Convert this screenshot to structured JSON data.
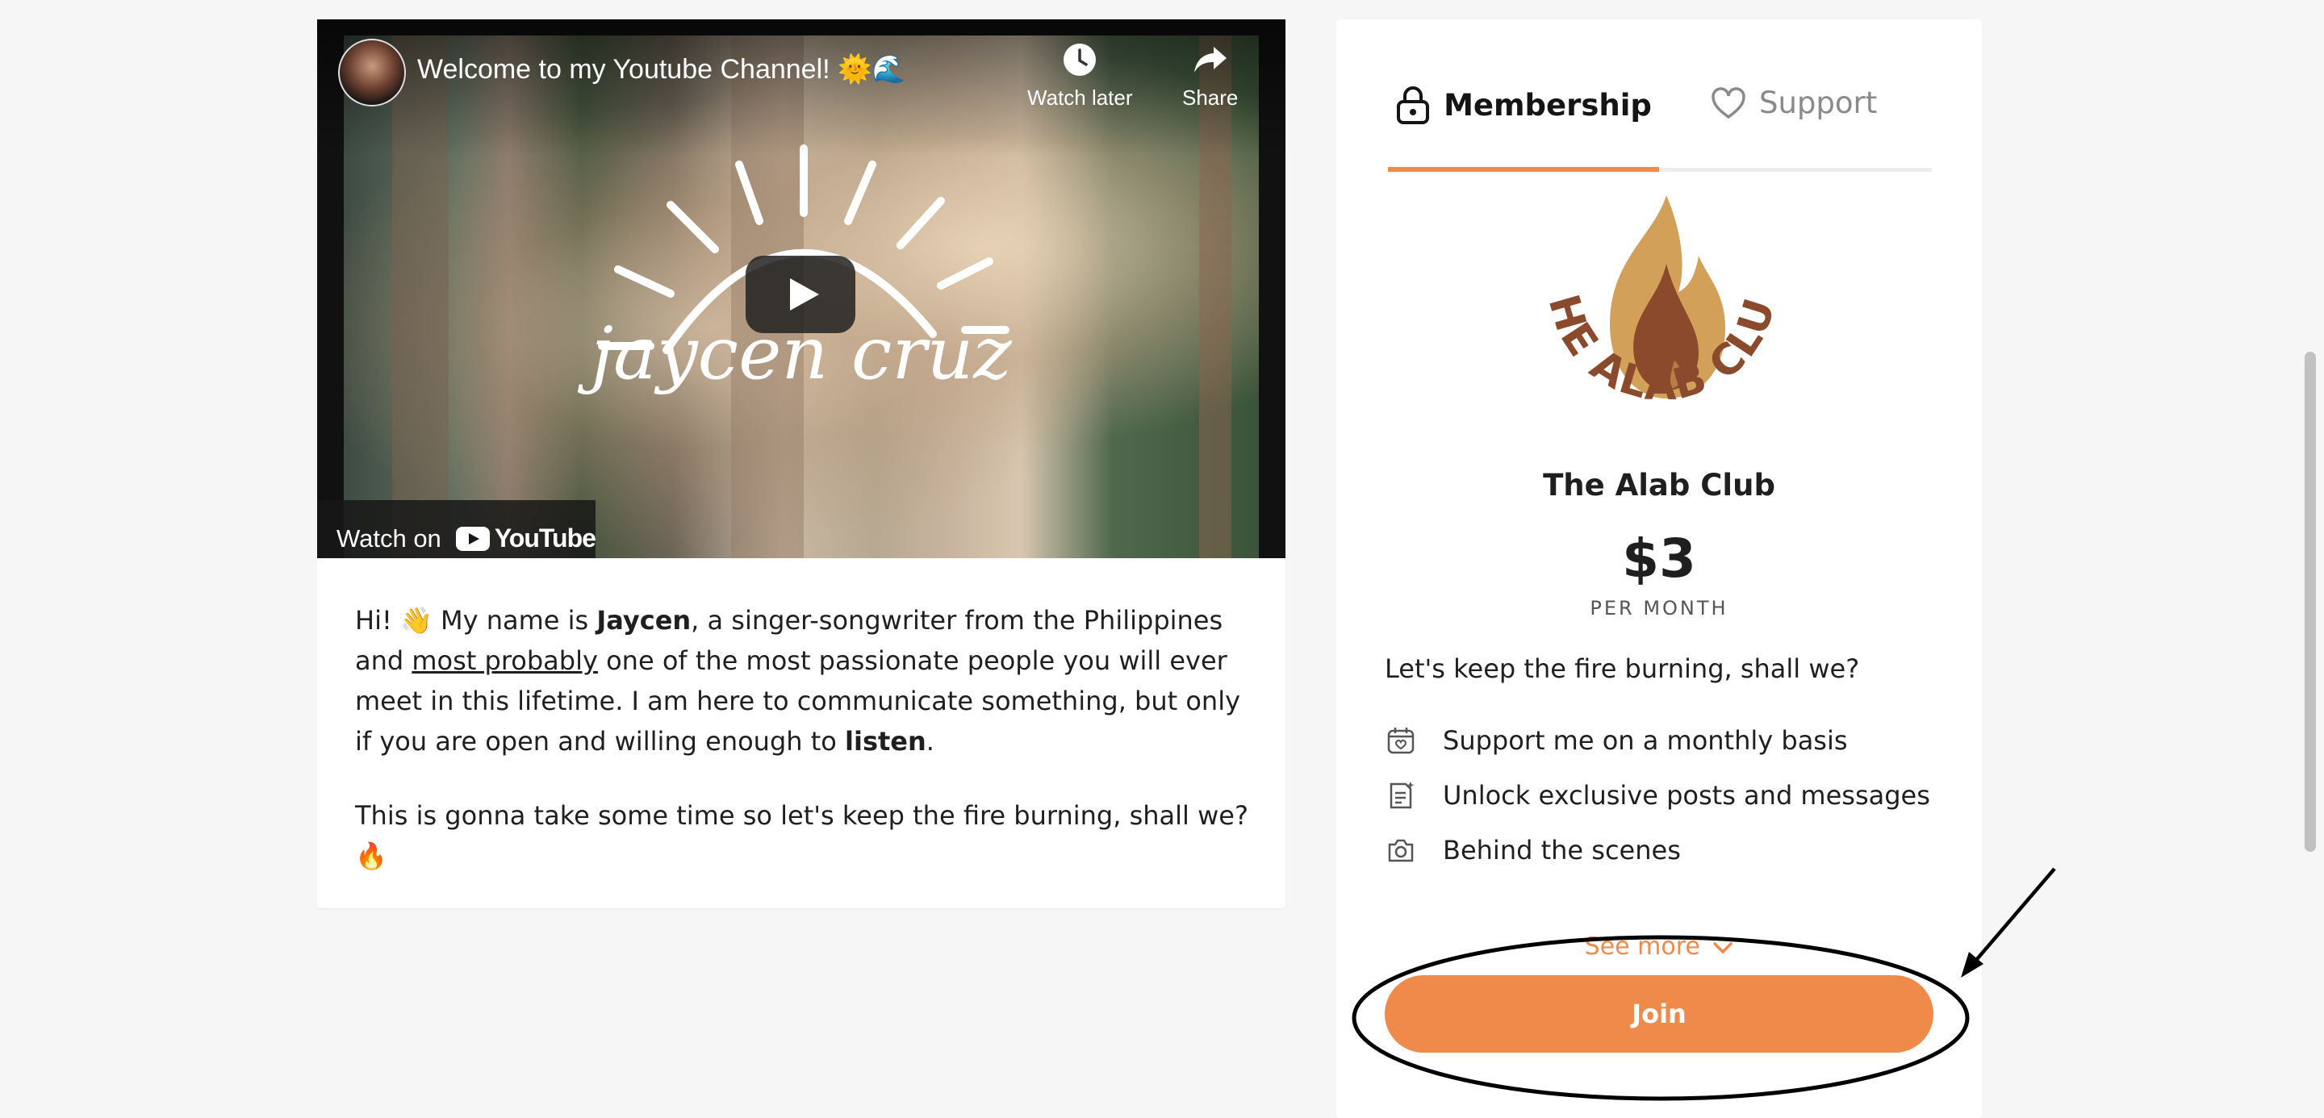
{
  "video": {
    "title": "Welcome to my Youtube Channel! 🌞🌊",
    "watch_later_label": "Watch later",
    "share_label": "Share",
    "watch_on_label": "Watch on",
    "youtube_label": "YouTube",
    "overlay_script": "jaycen cruz"
  },
  "bio": {
    "p1_a": "Hi! 👋 My name is ",
    "p1_name": "Jaycen",
    "p1_b": ", a singer-songwriter from the Philippines and ",
    "p1_link": "most probably",
    "p1_c": " one of the most passionate people you will ever meet in this lifetime. I am here to communicate something, but only if you are open and willing enough to ",
    "p1_bold": "listen",
    "p1_d": ".",
    "p2": "This is gonna take some time so let's keep the fire burning, shall we? 🔥"
  },
  "tabs": [
    {
      "label": "Membership",
      "icon": "lock-icon",
      "active": true
    },
    {
      "label": "Support",
      "icon": "heart-icon",
      "active": false
    }
  ],
  "membership": {
    "logo_text": "THE ALAB CLUB",
    "name": "The Alab Club",
    "price": "$3",
    "period": "PER MONTH",
    "tagline": "Let's keep the fire burning, shall we?",
    "benefits": [
      {
        "icon": "calendar-heart-icon",
        "text": "Support me on a monthly basis"
      },
      {
        "icon": "document-star-icon",
        "text": "Unlock exclusive posts and messages"
      },
      {
        "icon": "camera-icon",
        "text": "Behind the scenes"
      }
    ],
    "see_more": "See more",
    "join_label": "Join"
  },
  "colors": {
    "accent": "#f08a4b",
    "logo_brown": "#8b4a2b",
    "logo_tan": "#d3a05a"
  }
}
